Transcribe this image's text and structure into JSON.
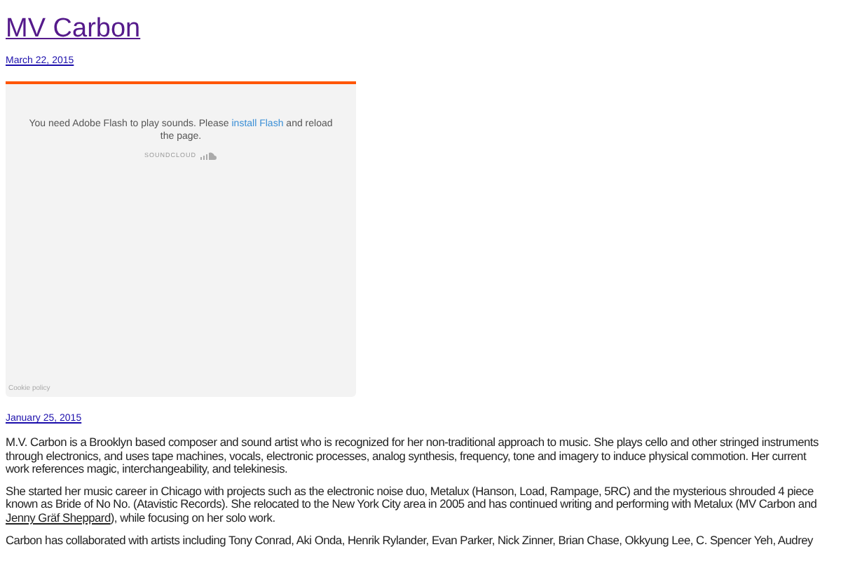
{
  "post_title": "MV Carbon",
  "posts": [
    {
      "date": "March 22, 2015",
      "embed": {
        "message": "You need Adobe Flash to play sounds. Please",
        "link": "install Flash",
        "message_end": "and reload the page.",
        "brand": "SOUNDCLOUD",
        "footer": "Cookie policy"
      }
    },
    {
      "date": "January 25, 2015",
      "paragraphs": [
        {
          "text": "M.V. Carbon is a Brooklyn based composer and sound artist who is recognized for her non-traditional approach to music. She plays cello and other stringed instruments through electronics, and uses tape machines, vocals, electronic processes, analog synthesis, frequency, tone and imagery to induce physical commotion. Her current work references magic, interchangeability, and  telekinesis."
        },
        {
          "text": "She started her music career in Chicago with projects such as the electronic noise duo, Metalux (Hanson, Load, Rampage, 5RC) and the mysterious shrouded 4 piece known as Bride of No No. (Atavistic Records). She relocated to the New York City area in 2005 and has continued writing and performing with Metalux (MV Carbon and",
          "link": "Jenny Gräf Sheppard",
          "after": "), while focusing on her solo work."
        },
        {
          "text": "Carbon has collaborated with artists including Tony Conrad, Aki Onda, Henrik Rylander, Evan Parker, Nick Zinner, Brian Chase, Okkyung Lee, C. Spencer Yeh, Audrey"
        }
      ]
    }
  ]
}
